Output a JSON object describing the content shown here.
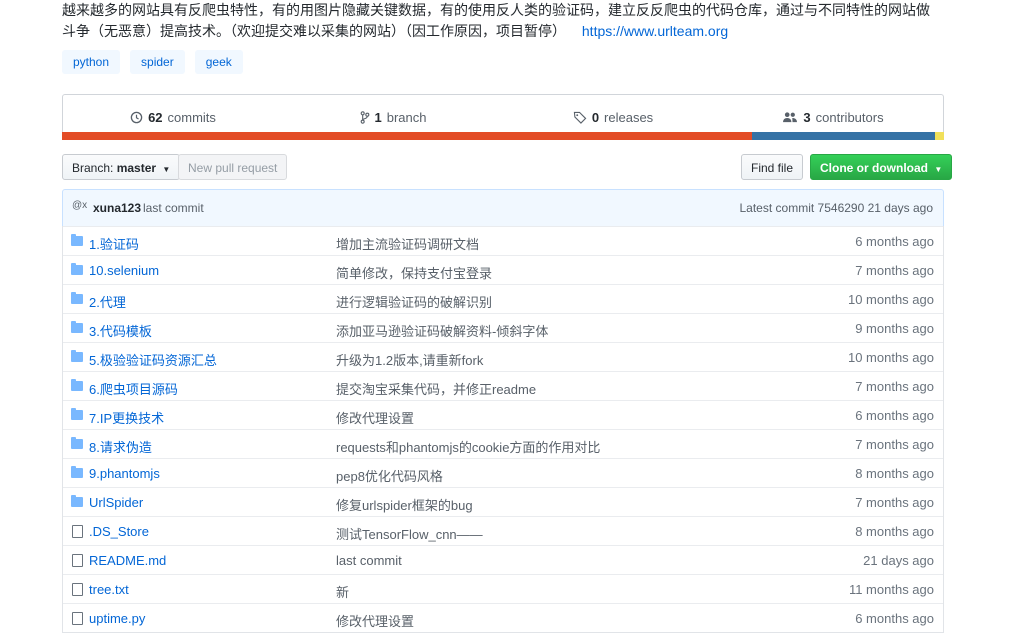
{
  "repo": {
    "description": "越来越多的网站具有反爬虫特性，有的用图片隐藏关键数据，有的使用反人类的验证码，建立反反爬虫的代码仓库，通过与不同特性的网站做斗争（无恶意）提高技术。（欢迎提交难以采集的网站）（因工作原因，项目暂停）",
    "website": "https://www.urlteam.org",
    "topics": [
      "python",
      "spider",
      "geek"
    ]
  },
  "numbers": {
    "commits": {
      "count": "62",
      "label": "commits",
      "icon": "history-icon"
    },
    "branches": {
      "count": "1",
      "label": "branch",
      "icon": "git-branch-icon"
    },
    "releases": {
      "count": "0",
      "label": "releases",
      "icon": "tag-icon"
    },
    "contributors": {
      "count": "3",
      "label": "contributors",
      "icon": "people-icon"
    }
  },
  "languages": [
    {
      "color": "#e34c26",
      "percent": 78.2
    },
    {
      "color": "#3572A5",
      "percent": 20.8
    },
    {
      "color": "#f1e05a",
      "percent": 1.0
    }
  ],
  "toolbar": {
    "branch_label": "Branch:",
    "branch_value": "master",
    "new_pr": "New pull request",
    "find_file": "Find file",
    "clone": "Clone or download"
  },
  "latest_commit": {
    "avatar_alt": "@x",
    "author": "xuna123",
    "message": "last commit",
    "label": "Latest commit",
    "sha": "7546290",
    "age": "21 days ago"
  },
  "files": [
    {
      "type": "dir",
      "name": "1.验证码",
      "message": "增加主流验证码调研文档",
      "age": "6 months ago"
    },
    {
      "type": "dir",
      "name": "10.selenium",
      "message": "简单修改，保持支付宝登录",
      "age": "7 months ago"
    },
    {
      "type": "dir",
      "name": "2.代理",
      "message": "进行逻辑验证码的破解识别",
      "age": "10 months ago"
    },
    {
      "type": "dir",
      "name": "3.代码模板",
      "message": "添加亚马逊验证码破解资料-倾斜字体",
      "age": "9 months ago"
    },
    {
      "type": "dir",
      "name": "5.极验验证码资源汇总",
      "message": "升级为1.2版本,请重新fork",
      "age": "10 months ago"
    },
    {
      "type": "dir",
      "name": "6.爬虫项目源码",
      "message": "提交淘宝采集代码，并修正readme",
      "age": "7 months ago"
    },
    {
      "type": "dir",
      "name": "7.IP更换技术",
      "message": "修改代理设置",
      "age": "6 months ago"
    },
    {
      "type": "dir",
      "name": "8.请求伪造",
      "message": "requests和phantomjs的cookie方面的作用对比",
      "age": "7 months ago"
    },
    {
      "type": "dir",
      "name": "9.phantomjs",
      "message": "pep8优化代码风格",
      "age": "8 months ago"
    },
    {
      "type": "dir",
      "name": "UrlSpider",
      "message": "修复urlspider框架的bug",
      "age": "7 months ago"
    },
    {
      "type": "file",
      "name": ".DS_Store",
      "message": "测试TensorFlow_cnn——",
      "age": "8 months ago"
    },
    {
      "type": "file",
      "name": "README.md",
      "message": "last commit",
      "age": "21 days ago"
    },
    {
      "type": "file",
      "name": "tree.txt",
      "message": "新",
      "age": "11 months ago"
    },
    {
      "type": "file",
      "name": "uptime.py",
      "message": "修改代理设置",
      "age": "6 months ago"
    }
  ]
}
